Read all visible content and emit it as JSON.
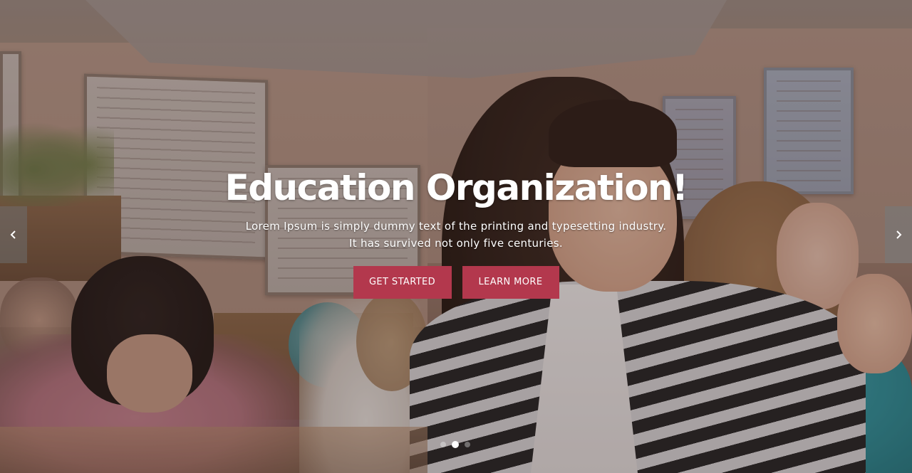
{
  "hero": {
    "title": "Education Organization!",
    "subtitle_line1": "Lorem Ipsum is simply dummy text of the printing and typesetting industry.",
    "subtitle_line2": "It has survived not only five centuries.",
    "buttons": {
      "get_started": "GET STARTED",
      "learn_more": "LEARN MORE"
    },
    "accent_color": "#b3384d"
  },
  "slider": {
    "prev_icon": "chevron-left-icon",
    "next_icon": "chevron-right-icon",
    "slide_count": 3,
    "active_slide": 2
  }
}
